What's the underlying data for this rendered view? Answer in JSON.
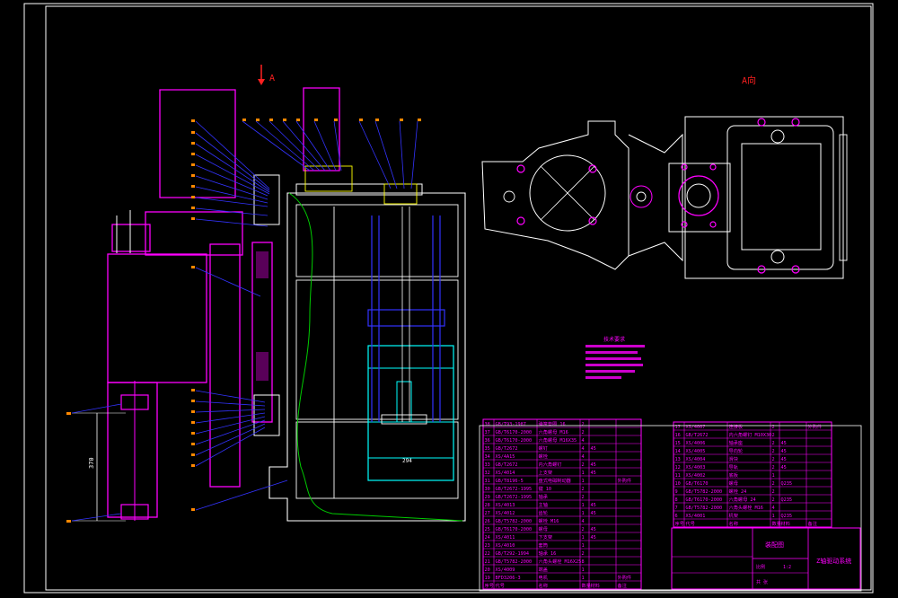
{
  "colors": {
    "background": "#000000",
    "frame": "#ffffff",
    "magenta": "#ff00ff",
    "white": "#ffffff",
    "blue": "#3333ff",
    "cyan": "#00ffff",
    "green": "#00cc00",
    "yellow": "#ffff00",
    "orange": "#ff8800"
  },
  "views": {
    "section_label": "A",
    "view_label": "A向"
  },
  "dimensions": {
    "height": "370",
    "width": "294"
  },
  "notes": {
    "title": "技术要求"
  },
  "bom_left": [
    {
      "no": "38",
      "code": "GB/T93-1987",
      "name": "弹簧垫圈 16",
      "qty": "2",
      "mat": "",
      "remark": ""
    },
    {
      "no": "37",
      "code": "GB/T6170-2000",
      "name": "六角螺母 M16",
      "qty": "2",
      "mat": "",
      "remark": ""
    },
    {
      "no": "36",
      "code": "GB/T6170-2000",
      "name": "六角螺母 M16X35",
      "qty": "4",
      "mat": "",
      "remark": ""
    },
    {
      "no": "35",
      "code": "GB/T2672",
      "name": "螺钉",
      "qty": "4",
      "mat": "45",
      "remark": ""
    },
    {
      "no": "34",
      "code": "XS/4A15",
      "name": "螺栓",
      "qty": "4",
      "mat": "",
      "remark": ""
    },
    {
      "no": "33",
      "code": "GB/T2672",
      "name": "内六角螺钉",
      "qty": "2",
      "mat": "45",
      "remark": ""
    },
    {
      "no": "32",
      "code": "XS/4014",
      "name": "上支架",
      "qty": "1",
      "mat": "45",
      "remark": ""
    },
    {
      "no": "31",
      "code": "GB/T8196-5",
      "name": "盘式电磁制动器",
      "qty": "1",
      "mat": "",
      "remark": "外购件"
    },
    {
      "no": "30",
      "code": "GB/T2672-1995",
      "name": "键 10",
      "qty": "2",
      "mat": "",
      "remark": ""
    },
    {
      "no": "29",
      "code": "GB/T2672-1995",
      "name": "轴承",
      "qty": "2",
      "mat": "",
      "remark": ""
    },
    {
      "no": "28",
      "code": "XS/4013",
      "name": "主轴",
      "qty": "1",
      "mat": "45",
      "remark": ""
    },
    {
      "no": "27",
      "code": "XS/4012",
      "name": "齿轮",
      "qty": "1",
      "mat": "45",
      "remark": ""
    },
    {
      "no": "26",
      "code": "GB/T5782-2000",
      "name": "螺栓 M16",
      "qty": "4",
      "mat": "",
      "remark": ""
    },
    {
      "no": "25",
      "code": "GB/T6170-2000",
      "name": "螺母",
      "qty": "2",
      "mat": "45",
      "remark": ""
    },
    {
      "no": "24",
      "code": "XS/4011",
      "name": "下支架",
      "qty": "1",
      "mat": "45",
      "remark": ""
    },
    {
      "no": "23",
      "code": "XS/4010",
      "name": "套筒",
      "qty": "1",
      "mat": "",
      "remark": ""
    },
    {
      "no": "22",
      "code": "GB/T292-1994",
      "name": "轴承 16",
      "qty": "2",
      "mat": "",
      "remark": ""
    },
    {
      "no": "21",
      "code": "GB/T5782-2000",
      "name": "六角头螺栓 M16X25",
      "qty": "8",
      "mat": "",
      "remark": ""
    },
    {
      "no": "20",
      "code": "XS/4009",
      "name": "端盖",
      "qty": "1",
      "mat": "",
      "remark": ""
    },
    {
      "no": "19",
      "code": "BFD3206-3",
      "name": "电机",
      "qty": "1",
      "mat": "",
      "remark": "外购件"
    }
  ],
  "bom_right": [
    {
      "no": "17",
      "code": "XS/4007",
      "name": "连接板",
      "qty": "2",
      "mat": "",
      "remark": "外购件"
    },
    {
      "no": "16",
      "code": "GB/T2672",
      "name": "内六角螺钉 M10X30",
      "qty": "2",
      "mat": "",
      "remark": ""
    },
    {
      "no": "15",
      "code": "XS/4006",
      "name": "轴承座",
      "qty": "2",
      "mat": "45",
      "remark": ""
    },
    {
      "no": "14",
      "code": "XS/4005",
      "name": "导向轮",
      "qty": "2",
      "mat": "45",
      "remark": ""
    },
    {
      "no": "13",
      "code": "XS/4004",
      "name": "滑块",
      "qty": "2",
      "mat": "45",
      "remark": ""
    },
    {
      "no": "12",
      "code": "XS/4003",
      "name": "导轨",
      "qty": "2",
      "mat": "45",
      "remark": ""
    },
    {
      "no": "11",
      "code": "XS/4002",
      "name": "底板",
      "qty": "1",
      "mat": "",
      "remark": ""
    },
    {
      "no": "10",
      "code": "GB/T6170",
      "name": "螺母",
      "qty": "2",
      "mat": "Q235",
      "remark": ""
    },
    {
      "no": "9",
      "code": "GB/T5782-2000",
      "name": "螺栓 24",
      "qty": "2",
      "mat": "",
      "remark": ""
    },
    {
      "no": "8",
      "code": "GB/T6170-2000",
      "name": "六角螺母 24",
      "qty": "2",
      "mat": "Q235",
      "remark": ""
    },
    {
      "no": "7",
      "code": "GB/T5782-2000",
      "name": "六角头螺栓 M16",
      "qty": "4",
      "mat": "",
      "remark": ""
    },
    {
      "no": "6",
      "code": "XS/4001",
      "name": "机架",
      "qty": "1",
      "mat": "Q235",
      "remark": ""
    }
  ],
  "bom_header": {
    "no": "序号",
    "code": "代号",
    "name": "名称",
    "qty": "数量",
    "mat": "材料",
    "remark": "备注"
  },
  "title_block": {
    "assembly_label": "装配图",
    "drawing_title": "Z轴驱动系统",
    "scale_label": "比例",
    "sheet_label": "共 张",
    "scale_value": "1:2"
  }
}
